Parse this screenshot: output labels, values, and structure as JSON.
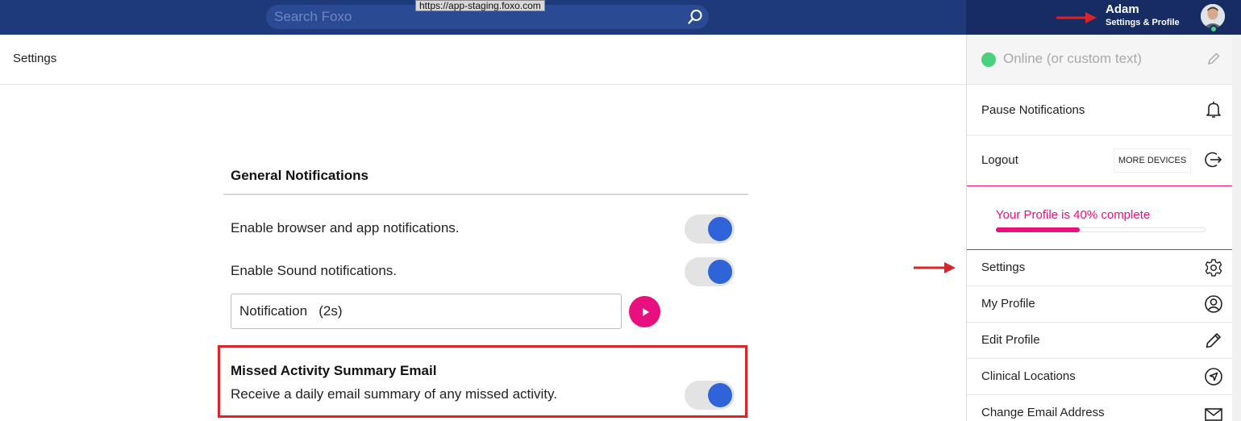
{
  "topbar": {
    "search_placeholder": "Search Foxo",
    "url_tooltip": "https://app-staging.foxo.com",
    "user_name": "Adam",
    "user_sub": "Settings & Profile"
  },
  "page": {
    "title": "Settings"
  },
  "general_notifications": {
    "title": "General Notifications",
    "browser_label": "Enable browser and app notifications.",
    "browser_enabled": true,
    "sound_label": "Enable Sound notifications.",
    "sound_enabled": true,
    "sound_choice": "Notification   (2s)"
  },
  "missed_activity": {
    "title": "Missed Activity Summary Email",
    "description": "Receive a daily email summary of any missed activity.",
    "enabled": true
  },
  "profile_menu": {
    "status_text": "Online (or custom text)",
    "pause_notifications": "Pause Notifications",
    "logout": "Logout",
    "more_devices": "MORE DEVICES",
    "profile_complete_text": "Your Profile is 40% complete",
    "profile_complete_fraction": 0.4,
    "items": [
      {
        "label": "Settings",
        "icon": "gear-icon"
      },
      {
        "label": "My Profile",
        "icon": "user-circle-icon"
      },
      {
        "label": "Edit Profile",
        "icon": "pencil-icon"
      },
      {
        "label": "Clinical Locations",
        "icon": "location-arrow-icon"
      },
      {
        "label": "Change Email Address",
        "icon": "envelope-icon"
      }
    ]
  },
  "colors": {
    "topbar": "#1e3a7b",
    "accent_pink": "#e8107f",
    "toggle_on": "#2f63d8",
    "online_green": "#4cd07d",
    "annotation_red": "#d9242a"
  }
}
